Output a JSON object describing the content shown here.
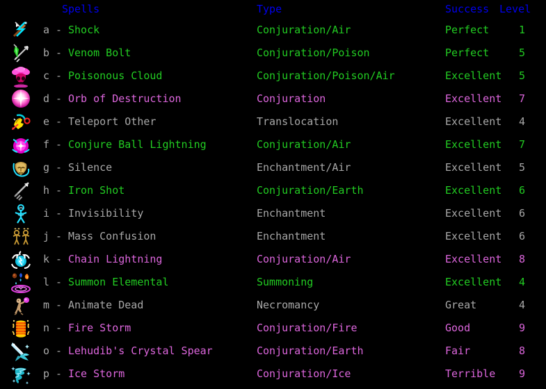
{
  "window": {
    "title": "Spells",
    "background": "#000000"
  },
  "palette": {
    "header": "#0000ee",
    "lightgrey": "#a8a8a8",
    "green": "#22cc22",
    "magenta": "#dd66dd",
    "background": "#000000"
  },
  "header": {
    "spells": "Spells",
    "type": "Type",
    "success": "Success",
    "level": "Level"
  },
  "separator": "-",
  "rows": [
    {
      "letter": "a",
      "name": "Shock",
      "type": "Conjuration/Air",
      "success": "Perfect",
      "level": "1",
      "color": "green",
      "icon": "wand-shock-icon"
    },
    {
      "letter": "b",
      "name": "Venom Bolt",
      "type": "Conjuration/Poison",
      "success": "Perfect",
      "level": "5",
      "color": "green",
      "icon": "venom-bolt-icon"
    },
    {
      "letter": "c",
      "name": "Poisonous Cloud",
      "type": "Conjuration/Poison/Air",
      "success": "Excellent",
      "level": "5",
      "color": "green",
      "icon": "poison-skull-cloud-icon"
    },
    {
      "letter": "d",
      "name": "Orb of Destruction",
      "type": "Conjuration",
      "success": "Excellent",
      "level": "7",
      "color": "magenta",
      "icon": "orb-of-destruction-icon"
    },
    {
      "letter": "e",
      "name": "Teleport Other",
      "type": "Translocation",
      "success": "Excellent",
      "level": "4",
      "color": "lightgrey",
      "icon": "teleport-hand-icon"
    },
    {
      "letter": "f",
      "name": "Conjure Ball Lightning",
      "type": "Conjuration/Air",
      "success": "Excellent",
      "level": "7",
      "color": "green",
      "icon": "ball-lightning-icon"
    },
    {
      "letter": "g",
      "name": "Silence",
      "type": "Enchantment/Air",
      "success": "Excellent",
      "level": "5",
      "color": "lightgrey",
      "icon": "silence-mask-icon"
    },
    {
      "letter": "h",
      "name": "Iron Shot",
      "type": "Conjuration/Earth",
      "success": "Excellent",
      "level": "6",
      "color": "green",
      "icon": "iron-shot-dart-icon"
    },
    {
      "letter": "i",
      "name": "Invisibility",
      "type": "Enchantment",
      "success": "Excellent",
      "level": "6",
      "color": "lightgrey",
      "icon": "invisibility-figure-icon"
    },
    {
      "letter": "j",
      "name": "Mass Confusion",
      "type": "Enchantment",
      "success": "Excellent",
      "level": "6",
      "color": "lightgrey",
      "icon": "mass-confusion-figures-icon"
    },
    {
      "letter": "k",
      "name": "Chain Lightning",
      "type": "Conjuration/Air",
      "success": "Excellent",
      "level": "8",
      "color": "magenta",
      "icon": "chain-lightning-orb-icon"
    },
    {
      "letter": "l",
      "name": "Summon Elemental",
      "type": "Summoning",
      "success": "Excellent",
      "level": "4",
      "color": "green",
      "icon": "summon-elemental-circle-icon"
    },
    {
      "letter": "m",
      "name": "Animate Dead",
      "type": "Necromancy",
      "success": "Great",
      "level": "4",
      "color": "lightgrey",
      "icon": "animate-dead-corpse-icon"
    },
    {
      "letter": "n",
      "name": "Fire Storm",
      "type": "Conjuration/Fire",
      "success": "Good",
      "level": "9",
      "color": "magenta",
      "icon": "fire-storm-column-icon"
    },
    {
      "letter": "o",
      "name": "Lehudib's Crystal Spear",
      "type": "Conjuration/Earth",
      "success": "Fair",
      "level": "8",
      "color": "magenta",
      "icon": "crystal-spear-icon"
    },
    {
      "letter": "p",
      "name": "Ice Storm",
      "type": "Conjuration/Ice",
      "success": "Terrible",
      "level": "9",
      "color": "magenta",
      "icon": "ice-storm-tornado-icon"
    }
  ]
}
